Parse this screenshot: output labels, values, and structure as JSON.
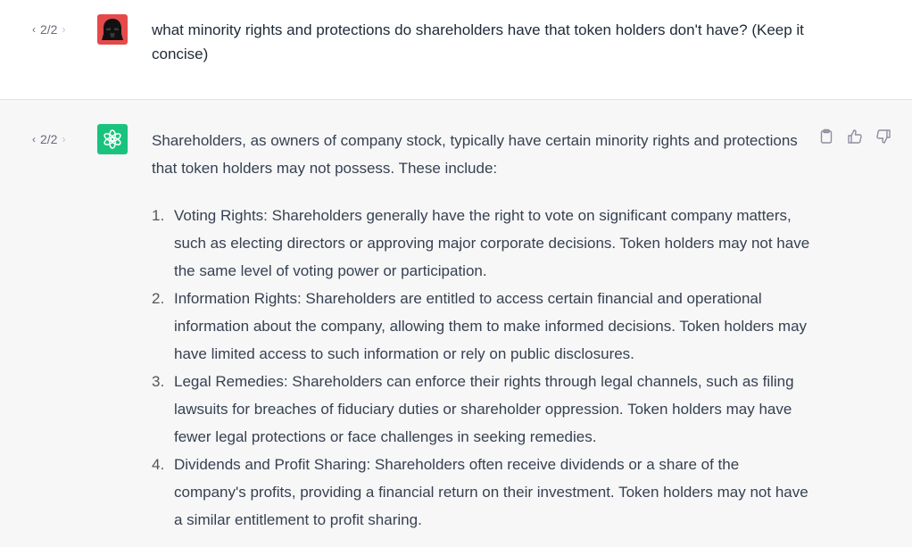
{
  "user_turn": {
    "pager": {
      "label": "2/2"
    },
    "avatar_icon": "darth-vader-avatar",
    "text": "what minority rights and protections do shareholders have that token holders don't have? (Keep it concise)"
  },
  "assistant_turn": {
    "pager": {
      "label": "2/2"
    },
    "avatar_icon": "openai-logo",
    "intro": "Shareholders, as owners of company stock, typically have certain minority rights and protections that token holders may not possess. These include:",
    "items": [
      {
        "num": "1.",
        "text": "Voting Rights: Shareholders generally have the right to vote on significant company matters, such as electing directors or approving major corporate decisions. Token holders may not have the same level of voting power or participation."
      },
      {
        "num": "2.",
        "text": "Information Rights: Shareholders are entitled to access certain financial and operational information about the company, allowing them to make informed decisions. Token holders may have limited access to such information or rely on public disclosures."
      },
      {
        "num": "3.",
        "text": "Legal Remedies: Shareholders can enforce their rights through legal channels, such as filing lawsuits for breaches of fiduciary duties or shareholder oppression. Token holders may have fewer legal protections or face challenges in seeking remedies."
      },
      {
        "num": "4.",
        "text": "Dividends and Profit Sharing: Shareholders often receive dividends or a share of the company's profits, providing a financial return on their investment. Token holders may not have a similar entitlement to profit sharing."
      }
    ],
    "actions": [
      {
        "icon": "clipboard-icon"
      },
      {
        "icon": "thumbs-up-icon"
      },
      {
        "icon": "thumbs-down-icon"
      }
    ]
  },
  "colors": {
    "user_avatar_bg": "#e44a4a",
    "assistant_avatar_bg": "#19c37d",
    "assistant_bg": "#f7f7f8"
  }
}
